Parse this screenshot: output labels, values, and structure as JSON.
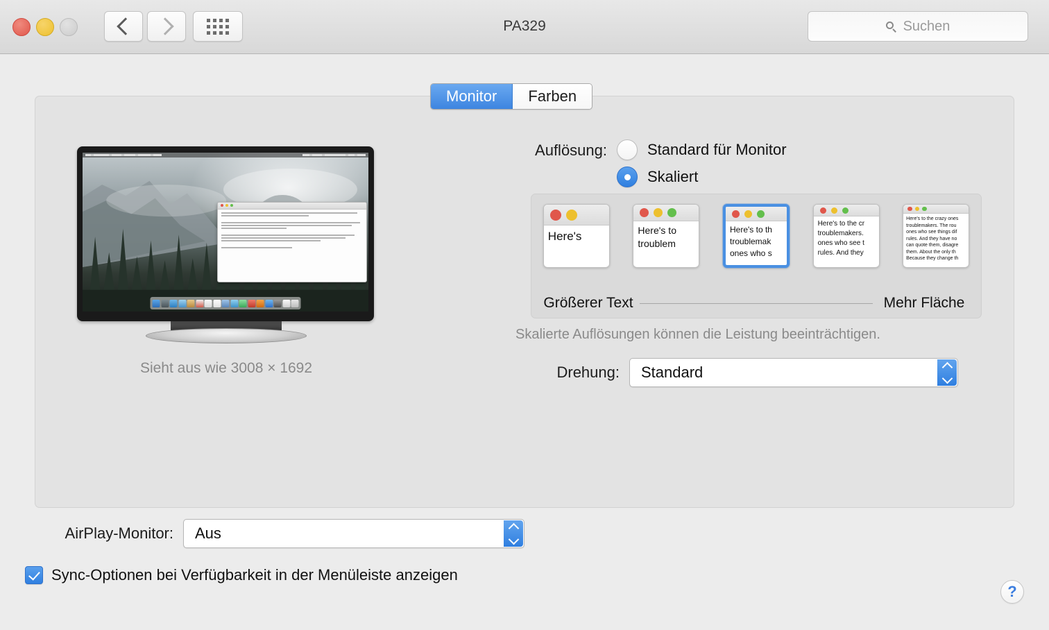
{
  "window": {
    "title": "PA329",
    "traffic_lights": [
      "close-button",
      "minimize-button",
      "zoom-button-disabled"
    ],
    "back_label": "back",
    "forward_label": "forward",
    "showall_label": "show-all"
  },
  "search": {
    "placeholder": "Suchen",
    "icon": "search-icon"
  },
  "tabs": [
    {
      "label": "Monitor",
      "selected": true
    },
    {
      "label": "Farben",
      "selected": false
    }
  ],
  "preview": {
    "caption": "Sieht aus wie 3008 × 1692",
    "desktop_window_lines": 11
  },
  "resolution": {
    "label": "Auflösung:",
    "options": [
      {
        "label": "Standard für Monitor",
        "selected": false
      },
      {
        "label": "Skaliert",
        "selected": true
      }
    ]
  },
  "scaling": {
    "left_label": "Größerer\nText",
    "right_label": "Mehr\nFläche",
    "selected_index": 2,
    "thumbnails": [
      {
        "lights": 2,
        "text": "Here's"
      },
      {
        "lights": 3,
        "text": "Here's to\ntroublem"
      },
      {
        "lights": 3,
        "text": "Here's to th\ntroublemak\nones who s"
      },
      {
        "lights": 3,
        "text": "Here's to the cr\ntroublemakers.\nones who see t\nrules. And they"
      },
      {
        "lights": 3,
        "text": "Here's to the crazy ones\ntroublemakers. The rou\nones who see things dif\nrules. And they have no\ncan quote them, disagre\nthem. About the only th\nBecause they change th"
      }
    ],
    "warning": "Skalierte Auflösungen können die Leistung beeinträchtigen."
  },
  "rotation": {
    "label": "Drehung:",
    "value": "Standard"
  },
  "airplay": {
    "label": "AirPlay-Monitor:",
    "value": "Aus"
  },
  "sync_checkbox": {
    "label": "Sync-Optionen bei Verfügbarkeit in der Menüleiste anzeigen",
    "checked": true
  },
  "help": {
    "glyph": "?"
  },
  "colors": {
    "accent": "#3d85e0",
    "selection_border": "#4a90e2",
    "window_bg": "#ececec",
    "panel_bg": "#e3e3e3",
    "inset_bg": "#dadada",
    "traffic_red": "#e0574b",
    "traffic_yellow": "#edc02e",
    "traffic_green": "#63bf4c",
    "muted_text": "#8a8a8a"
  }
}
